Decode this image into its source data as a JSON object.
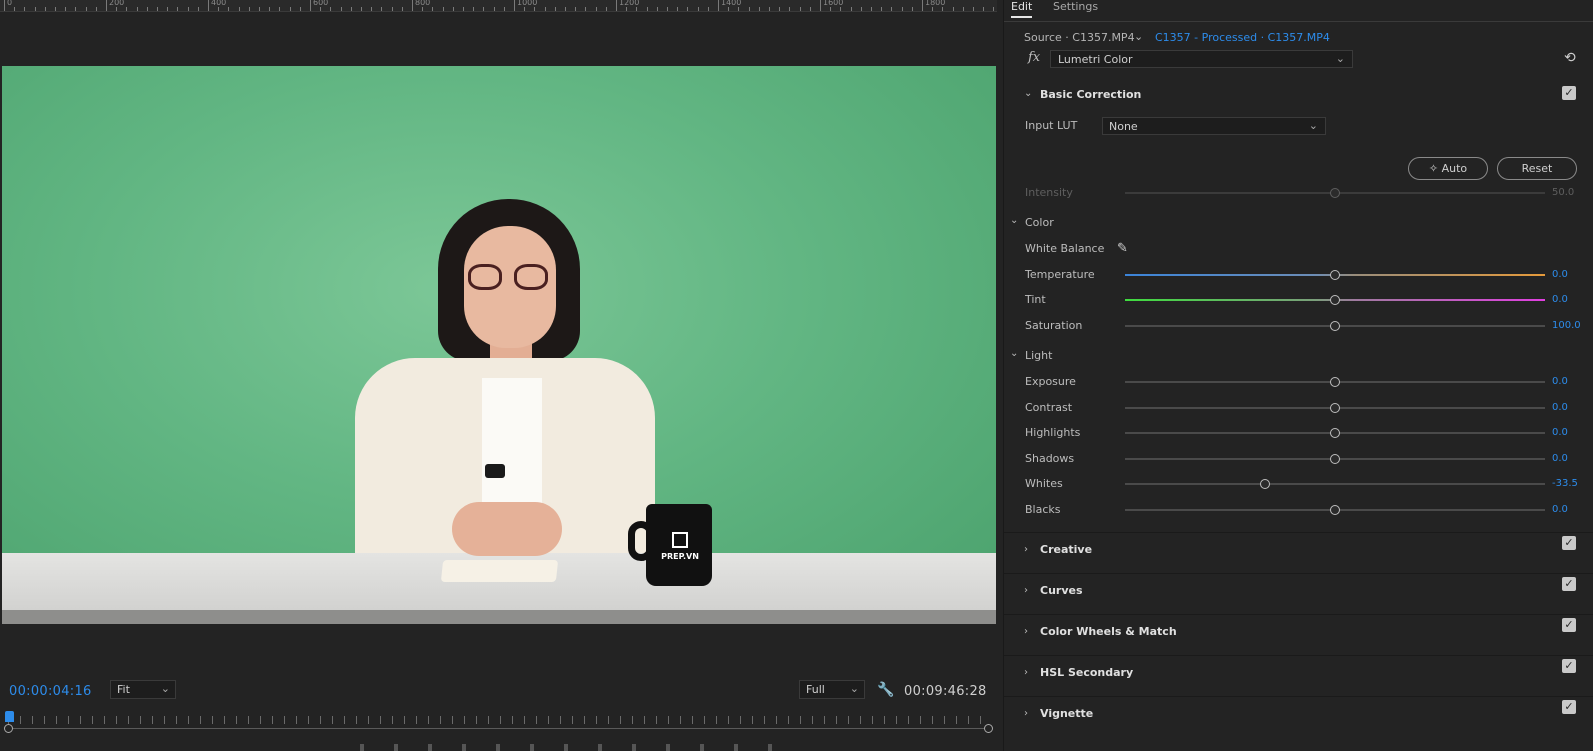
{
  "ruler": {
    "labels": [
      "0",
      "200",
      "400",
      "600",
      "800",
      "1000",
      "1200",
      "1400",
      "1600",
      "1800"
    ]
  },
  "monitor": {
    "timecode_current": "00:00:04:16",
    "zoom": "Fit",
    "resolution": "Full",
    "timecode_duration": "00:09:46:28",
    "mug_text": "PREP.VN"
  },
  "panel": {
    "tabs": [
      {
        "label": "Edit"
      },
      {
        "label": "Settings"
      }
    ],
    "source_label": "Source · C1357.MP4",
    "clip_label": "C1357 - Processed · C1357.MP4",
    "fx_label": "fx",
    "effect": "Lumetri Color",
    "basic": {
      "title": "Basic Correction",
      "input_lut_label": "Input LUT",
      "input_lut_value": "None",
      "auto_label": "Auto",
      "reset_label": "Reset",
      "intensity": {
        "label": "Intensity",
        "value": "50.0",
        "level": 0.5
      },
      "color_title": "Color",
      "white_balance_label": "White Balance",
      "temperature": {
        "label": "Temperature",
        "value": "0.0",
        "level": 0.5
      },
      "tint": {
        "label": "Tint",
        "value": "0.0",
        "level": 0.5
      },
      "saturation": {
        "label": "Saturation",
        "value": "100.0",
        "level": 0.5
      },
      "light_title": "Light",
      "exposure": {
        "label": "Exposure",
        "value": "0.0",
        "level": 0.5
      },
      "contrast": {
        "label": "Contrast",
        "value": "0.0",
        "level": 0.5
      },
      "highlights": {
        "label": "Highlights",
        "value": "0.0",
        "level": 0.5
      },
      "shadows": {
        "label": "Shadows",
        "value": "0.0",
        "level": 0.5
      },
      "whites": {
        "label": "Whites",
        "value": "-33.5",
        "level": 0.3325
      },
      "blacks": {
        "label": "Blacks",
        "value": "0.0",
        "level": 0.5
      }
    },
    "sections": [
      {
        "title": "Creative"
      },
      {
        "title": "Curves"
      },
      {
        "title": "Color Wheels & Match"
      },
      {
        "title": "HSL Secondary"
      },
      {
        "title": "Vignette"
      }
    ]
  },
  "colors": {
    "accent": "#2d8ceb",
    "panel_bg": "#232323",
    "screen_green": "#62b683"
  },
  "icons": {
    "wrench": "wrench-icon",
    "eyedropper": "eyedropper-icon",
    "reset": "reset-icon",
    "magic": "magic-wand-icon"
  }
}
